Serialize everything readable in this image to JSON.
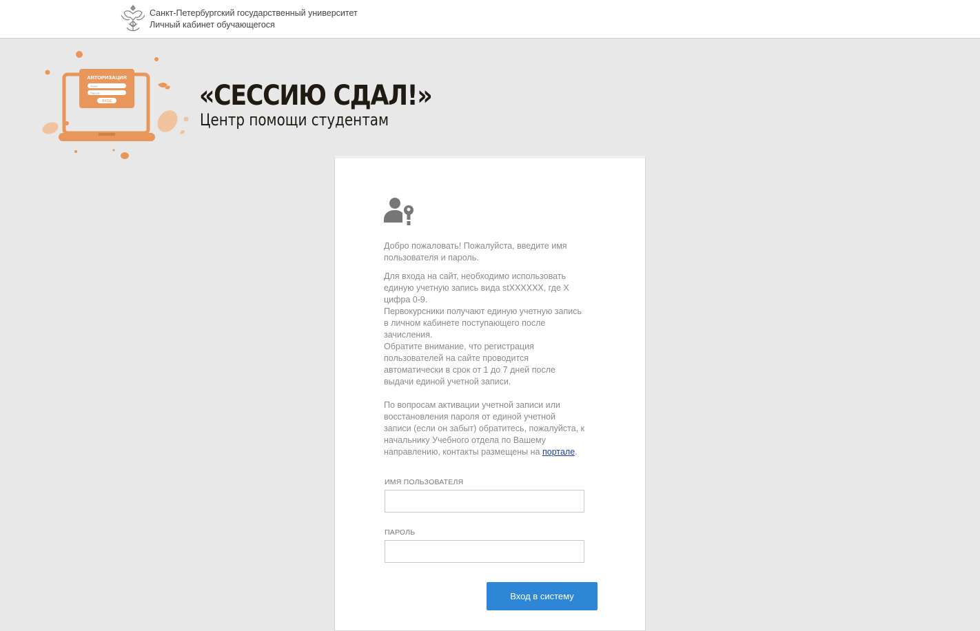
{
  "header": {
    "university": "Санкт-Петербургский государственный университет",
    "cabinet": "Личный кабинет обучающегося"
  },
  "promo": {
    "title": "«СЕССИЮ СДАЛ!»",
    "subtitle": "Центр помощи студентам",
    "laptop_screen_title": "АВТОРИЗАЦИЯ",
    "laptop_field_login": "Логин",
    "laptop_field_password": "Пароль",
    "laptop_button": "ВХОД"
  },
  "login": {
    "welcome": "Добро пожаловать! Пожалуйста, введите имя пользователя и пароль.",
    "info_lines": [
      "Для входа на сайт, необходимо использовать единую учетную запись вида stXXXXXX, где X цифра 0-9.",
      "Первокурсники получают единую учетную запись в личном кабинете поступающего после зачисления.",
      "Обратите внимание, что регистрация пользователей на сайте проводится автоматически в срок от 1 до 7 дней после выдачи единой учетной записи."
    ],
    "contact_text": "По вопросам активации учетной записи или восстановления пароля от единой учетной записи (если он забыт) обратитесь, пожалуйста, к начальнику Учебного отдела по Вашему направлению, контакты размещены на",
    "contact_link": "портале",
    "contact_end": ".",
    "username_label": "ИМЯ ПОЛЬЗОВАТЕЛЯ",
    "username_value": "",
    "password_label": "ПАРОЛЬ",
    "password_value": "",
    "submit_label": "Вход в систему"
  },
  "colors": {
    "accent_orange": "#e8965a",
    "button_blue": "#2e86d6",
    "page_bg": "#e8e8e8"
  },
  "icons": {
    "university_logo": "spbu-crest-icon",
    "user_key": "user-key-icon"
  }
}
